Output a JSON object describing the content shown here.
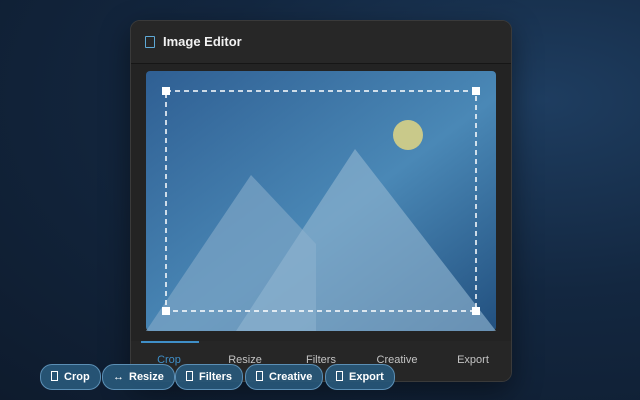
{
  "window": {
    "title": "Image Editor"
  },
  "tabs": [
    {
      "label": "Crop",
      "active": true
    },
    {
      "label": "Resize",
      "active": false
    },
    {
      "label": "Filters",
      "active": false
    },
    {
      "label": "Creative",
      "active": false
    },
    {
      "label": "Export",
      "active": false
    }
  ],
  "quick_actions": [
    {
      "label": "Crop",
      "icon": "crop-icon"
    },
    {
      "label": "Resize",
      "icon": "resize-arrows-icon",
      "glyph": "↔"
    },
    {
      "label": "Filters",
      "icon": "filters-icon"
    },
    {
      "label": "Creative",
      "icon": "creative-icon"
    },
    {
      "label": "Export",
      "icon": "export-icon"
    }
  ],
  "colors": {
    "accent": "#3f8fc8",
    "chip_bg": "#28587a",
    "image_sky": "#4a88b6",
    "sun": "#c9c98a"
  }
}
